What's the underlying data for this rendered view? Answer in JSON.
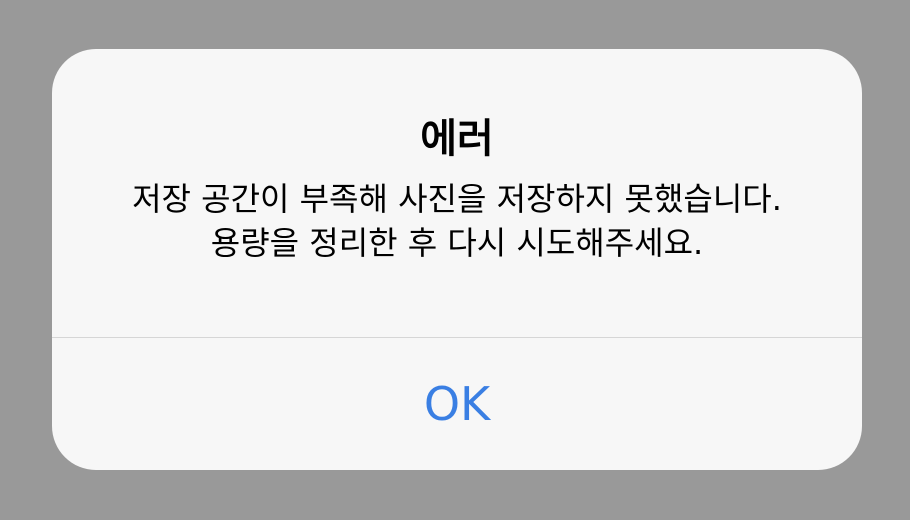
{
  "dialog": {
    "title": "에러",
    "message": "저장 공간이 부족해 사진을 저장하지 못했습니다. 용량을 정리한 후 다시 시도해주세요.",
    "ok_label": "OK"
  },
  "colors": {
    "backdrop": "#999999",
    "dialog_background": "#f7f7f7",
    "divider": "#d6d6d6",
    "button_text": "#3a7fe3"
  }
}
